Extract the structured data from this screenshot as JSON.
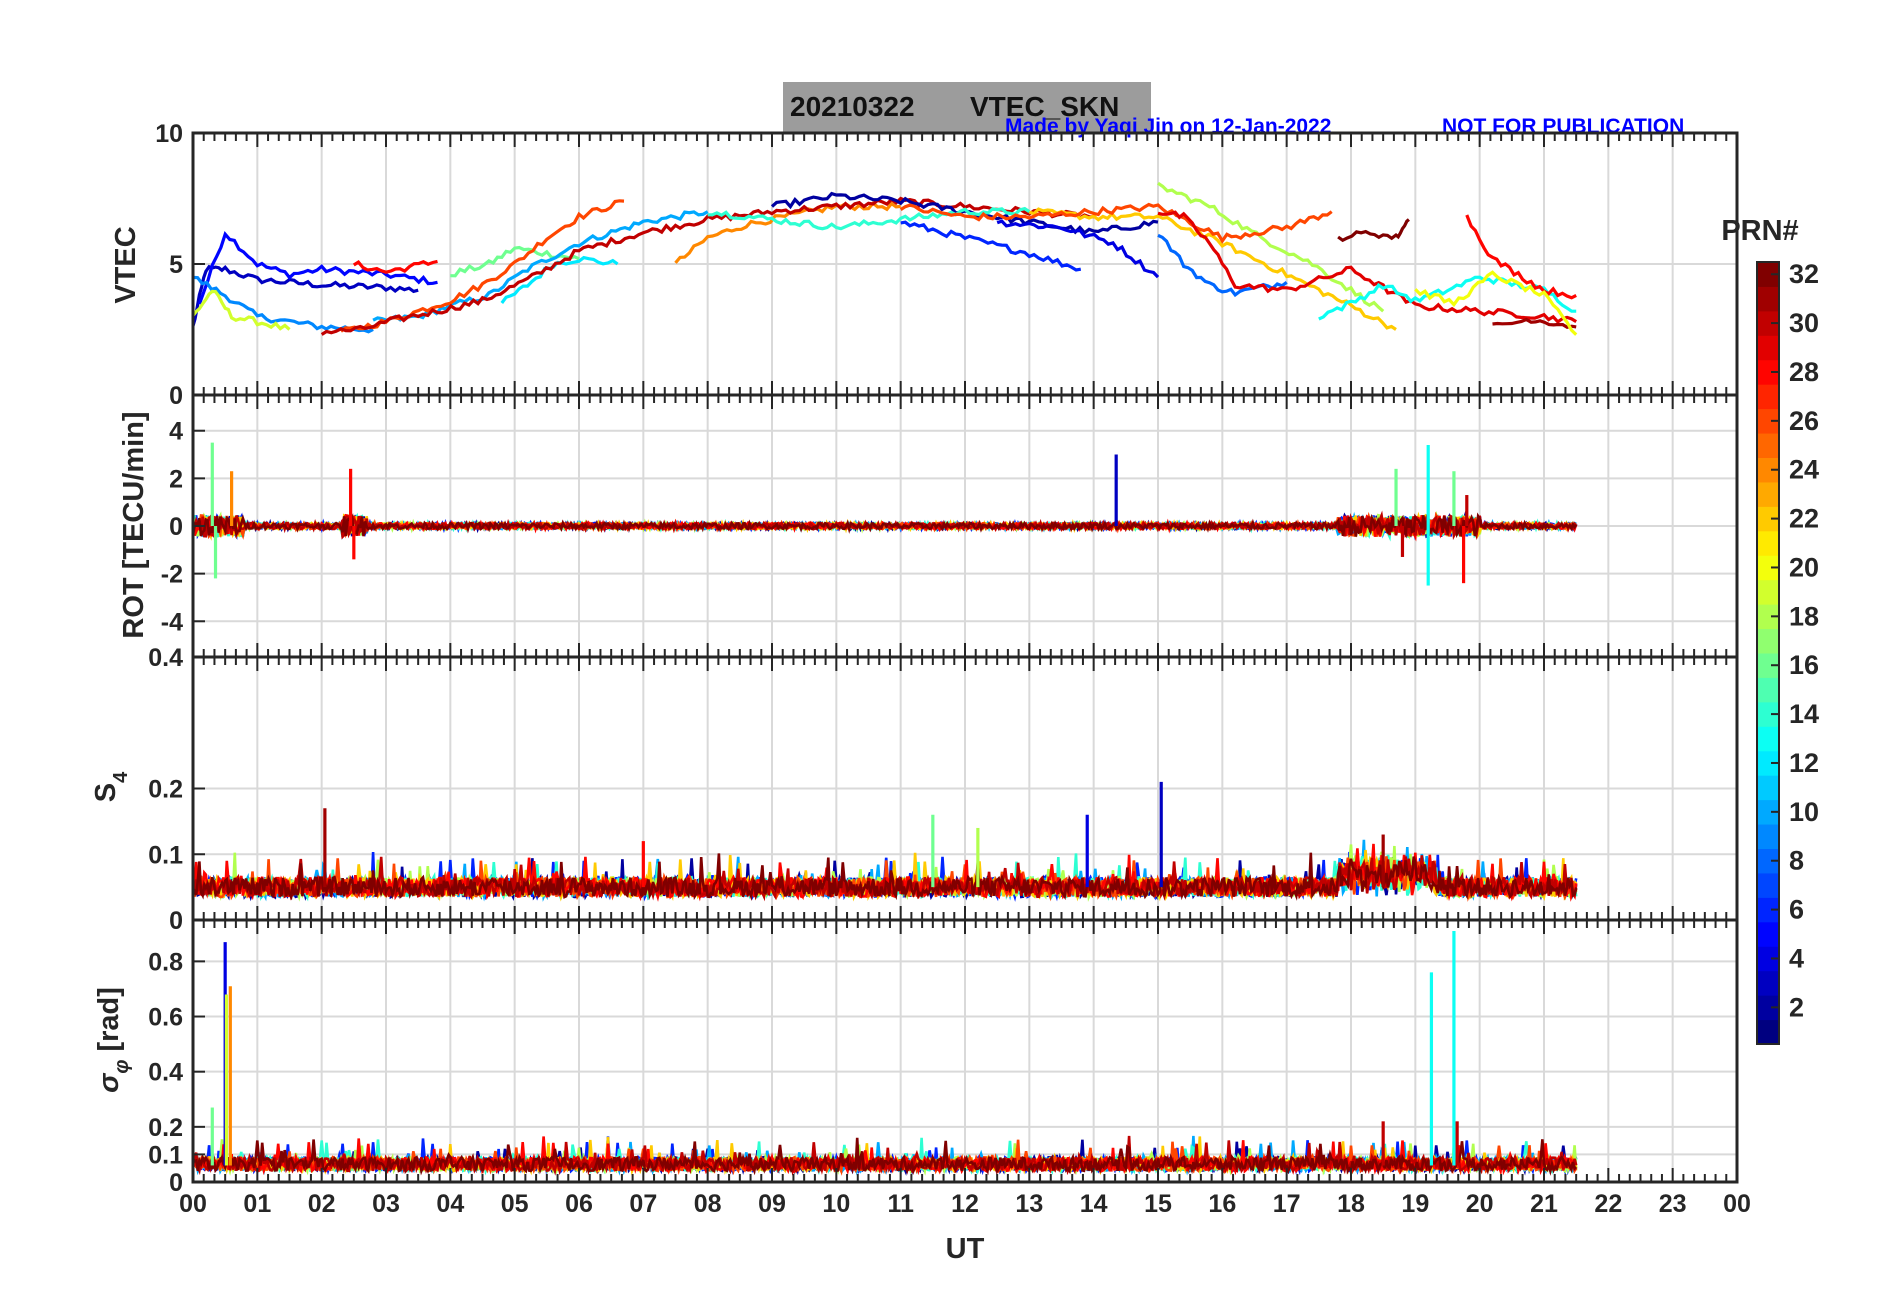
{
  "title": {
    "date": "20210322",
    "product": "VTEC_SKN"
  },
  "note": {
    "made_by": "Made by Yaqi Jin on 12-Jan-2022",
    "disclaimer": "NOT FOR PUBLICATION"
  },
  "colors": {
    "title_bg": "#9c9c9c",
    "note": "#0000ff",
    "grid": "#d9d9d9",
    "axis": "#262626"
  },
  "chart_data": [
    {
      "type": "line",
      "panel": "vtec",
      "ylabel": "VTEC",
      "ylim": [
        0,
        10
      ],
      "yticks": [
        0,
        5,
        10
      ],
      "grid": true,
      "series": [
        {
          "prn": 3,
          "x": [
            0.0,
            0.2,
            0.5,
            1.0,
            2.0,
            3.0,
            3.5
          ],
          "y": [
            2.6,
            4.8,
            4.8,
            4.4,
            4.2,
            4.1,
            4.0
          ]
        },
        {
          "prn": 5,
          "x": [
            0.1,
            0.5,
            1.0,
            1.5,
            2.0,
            3.0,
            3.8
          ],
          "y": [
            3.5,
            6.2,
            5.0,
            4.6,
            4.8,
            4.6,
            4.3
          ]
        },
        {
          "prn": 9,
          "x": [
            0.0,
            0.5,
            1.0,
            1.5,
            2.0,
            2.8
          ],
          "y": [
            4.5,
            3.8,
            3.0,
            2.8,
            2.6,
            2.5
          ]
        },
        {
          "prn": 12,
          "x": [
            4.8,
            5.2,
            5.6,
            6.0,
            6.6
          ],
          "y": [
            3.5,
            4.2,
            5.0,
            5.2,
            5.0
          ]
        },
        {
          "prn": 16,
          "x": [
            4.0,
            4.6,
            5.0,
            5.5,
            6.0
          ],
          "y": [
            4.6,
            5.0,
            5.6,
            5.4,
            5.2
          ]
        },
        {
          "prn": 19,
          "x": [
            0.0,
            0.3,
            0.6,
            1.0,
            1.5
          ],
          "y": [
            3.0,
            4.0,
            3.0,
            2.8,
            2.5
          ]
        },
        {
          "prn": 10,
          "x": [
            2.8,
            3.5,
            4.0,
            4.6,
            5.2,
            6.0,
            7.0,
            8.0
          ],
          "y": [
            2.8,
            3.0,
            3.4,
            3.8,
            4.8,
            5.8,
            6.6,
            7.0
          ]
        },
        {
          "prn": 24,
          "x": [
            7.5,
            8.0,
            8.6,
            9.2,
            10.0,
            11.0
          ],
          "y": [
            5.0,
            6.0,
            6.5,
            6.8,
            7.2,
            7.2
          ]
        },
        {
          "prn": 26,
          "x": [
            2.3,
            3.0,
            3.5,
            4.0,
            4.5,
            5.0,
            5.5,
            6.0,
            6.7
          ],
          "y": [
            2.4,
            2.8,
            3.2,
            3.6,
            4.2,
            5.0,
            6.0,
            6.8,
            7.4
          ]
        },
        {
          "prn": 28,
          "x": [
            2.5,
            3.0,
            3.8
          ],
          "y": [
            5.0,
            4.7,
            5.1
          ]
        },
        {
          "prn": 30,
          "x": [
            2.0,
            2.6,
            3.2,
            3.8,
            4.5,
            5.2,
            6.0,
            7.0,
            8.0,
            9.0,
            10.0,
            11.0,
            12.0,
            13.0,
            14.0
          ],
          "y": [
            2.4,
            2.5,
            2.9,
            3.2,
            3.6,
            4.4,
            5.5,
            6.2,
            6.7,
            7.0,
            7.2,
            7.4,
            7.2,
            7.0,
            6.8
          ]
        },
        {
          "prn": 2,
          "x": [
            9.0,
            10.0,
            11.0,
            12.0,
            13.0,
            14.0,
            15.0
          ],
          "y": [
            7.2,
            7.6,
            7.4,
            7.0,
            6.6,
            6.2,
            6.6
          ]
        },
        {
          "prn": 6,
          "x": [
            11.0,
            12.0,
            13.0,
            13.8
          ],
          "y": [
            6.6,
            6.0,
            5.4,
            4.8
          ]
        },
        {
          "prn": 4,
          "x": [
            12.5,
            13.5,
            14.3,
            15.0
          ],
          "y": [
            6.6,
            6.4,
            5.8,
            4.5
          ]
        },
        {
          "prn": 8,
          "x": [
            15.0,
            15.4,
            15.8,
            16.2,
            17.0
          ],
          "y": [
            6.2,
            5.0,
            4.2,
            3.9,
            4.3
          ]
        },
        {
          "prn": 14,
          "x": [
            8.0,
            9.0,
            10.0,
            11.0,
            12.0,
            13.0
          ],
          "y": [
            7.0,
            6.7,
            6.4,
            6.7,
            7.0,
            7.0
          ]
        },
        {
          "prn": 18,
          "x": [
            15.0,
            15.8,
            16.6,
            17.4,
            18.0,
            18.5
          ],
          "y": [
            8.0,
            7.2,
            6.0,
            5.0,
            4.0,
            3.2
          ]
        },
        {
          "prn": 22,
          "x": [
            13.0,
            14.0,
            15.0,
            16.0,
            17.0,
            18.0,
            18.7
          ],
          "y": [
            7.0,
            6.8,
            6.8,
            5.8,
            4.6,
            3.4,
            2.5
          ]
        },
        {
          "prn": 26,
          "x": [
            11.0,
            12.0,
            13.0,
            14.0,
            15.0,
            16.0,
            17.0,
            17.7
          ],
          "y": [
            7.2,
            6.8,
            6.8,
            7.0,
            7.2,
            6.0,
            6.4,
            7.0
          ]
        },
        {
          "prn": 29,
          "x": [
            15.0,
            15.4,
            15.8,
            16.2,
            17.0,
            18.0,
            19.0,
            20.0,
            21.0,
            21.5
          ],
          "y": [
            7.0,
            6.8,
            5.8,
            4.2,
            4.0,
            4.8,
            3.4,
            3.2,
            3.0,
            2.8
          ]
        },
        {
          "prn": 32,
          "x": [
            17.8,
            18.3,
            18.7,
            18.9
          ],
          "y": [
            6.0,
            6.2,
            6.0,
            6.7
          ]
        },
        {
          "prn": 13,
          "x": [
            17.5,
            18.0,
            18.5,
            19.0,
            19.5,
            20.0,
            21.0,
            21.5
          ],
          "y": [
            3.0,
            3.5,
            4.2,
            3.6,
            4.0,
            4.5,
            4.0,
            3.2
          ]
        },
        {
          "prn": 28,
          "x": [
            19.8,
            20.2,
            20.6,
            21.0,
            21.5
          ],
          "y": [
            6.8,
            5.2,
            4.6,
            4.0,
            3.8
          ]
        },
        {
          "prn": 31,
          "x": [
            20.2,
            20.8,
            21.5
          ],
          "y": [
            2.6,
            2.9,
            2.6
          ]
        },
        {
          "prn": 20,
          "x": [
            19.0,
            19.6,
            20.2,
            21.0,
            21.5
          ],
          "y": [
            4.0,
            3.5,
            4.6,
            3.8,
            2.3
          ]
        }
      ]
    },
    {
      "type": "line",
      "panel": "rot",
      "ylabel": "ROT [TECU/min]",
      "ylim": [
        -5.5,
        5.5
      ],
      "yticks": [
        -4,
        -2,
        0,
        2,
        4
      ],
      "grid": true,
      "spikes": [
        {
          "prn": 16,
          "x": 0.3,
          "y": 3.5
        },
        {
          "prn": 16,
          "x": 0.35,
          "y": -2.2
        },
        {
          "prn": 24,
          "x": 0.6,
          "y": 2.3
        },
        {
          "prn": 28,
          "x": 2.45,
          "y": 2.4
        },
        {
          "prn": 28,
          "x": 2.5,
          "y": -1.4
        },
        {
          "prn": 3,
          "x": 14.35,
          "y": 3.0
        },
        {
          "prn": 16,
          "x": 18.7,
          "y": 2.4
        },
        {
          "prn": 30,
          "x": 18.8,
          "y": -1.3
        },
        {
          "prn": 13,
          "x": 19.2,
          "y": 3.4
        },
        {
          "prn": 13,
          "x": 19.2,
          "y": -2.5
        },
        {
          "prn": 16,
          "x": 19.6,
          "y": 2.3
        },
        {
          "prn": 28,
          "x": 19.75,
          "y": -2.4
        },
        {
          "prn": 30,
          "x": 19.8,
          "y": 1.3
        }
      ]
    },
    {
      "type": "line",
      "panel": "s4",
      "ylabel": "S4",
      "ylim": [
        0,
        0.4
      ],
      "yticks": [
        0,
        0.1,
        0.2,
        0.4
      ],
      "grid": true,
      "spikes": [
        {
          "prn": 31,
          "x": 2.05,
          "y": 0.17
        },
        {
          "prn": 28,
          "x": 7.0,
          "y": 0.12
        },
        {
          "prn": 16,
          "x": 11.5,
          "y": 0.16
        },
        {
          "prn": 18,
          "x": 12.2,
          "y": 0.14
        },
        {
          "prn": 4,
          "x": 13.9,
          "y": 0.16
        },
        {
          "prn": 3,
          "x": 15.05,
          "y": 0.21
        },
        {
          "prn": 31,
          "x": 18.5,
          "y": 0.13
        }
      ]
    },
    {
      "type": "line",
      "panel": "sigma",
      "ylabel": "σφ [rad]",
      "ylim": [
        0,
        0.95
      ],
      "yticks": [
        0,
        0.1,
        0.2,
        0.4,
        0.6,
        0.8
      ],
      "grid": true,
      "spikes": [
        {
          "prn": 16,
          "x": 0.3,
          "y": 0.27
        },
        {
          "prn": 4,
          "x": 0.5,
          "y": 0.87
        },
        {
          "prn": 19,
          "x": 0.52,
          "y": 0.68
        },
        {
          "prn": 24,
          "x": 0.58,
          "y": 0.71
        },
        {
          "prn": 30,
          "x": 18.5,
          "y": 0.22
        },
        {
          "prn": 13,
          "x": 19.25,
          "y": 0.76
        },
        {
          "prn": 13,
          "x": 19.6,
          "y": 0.91
        },
        {
          "prn": 30,
          "x": 19.65,
          "y": 0.22
        }
      ]
    }
  ],
  "x_axis": {
    "label": "UT",
    "range": [
      0,
      24
    ],
    "ticks": [
      "00",
      "01",
      "02",
      "03",
      "04",
      "05",
      "06",
      "07",
      "08",
      "09",
      "10",
      "11",
      "12",
      "13",
      "14",
      "15",
      "16",
      "17",
      "18",
      "19",
      "20",
      "21",
      "22",
      "23",
      "00"
    ],
    "data_end": 21.5
  },
  "colorbar": {
    "title": "PRN#",
    "range": [
      1,
      32
    ],
    "ticks": [
      2,
      4,
      6,
      8,
      10,
      12,
      14,
      16,
      18,
      20,
      22,
      24,
      26,
      28,
      30,
      32
    ],
    "colormap": "jet"
  }
}
